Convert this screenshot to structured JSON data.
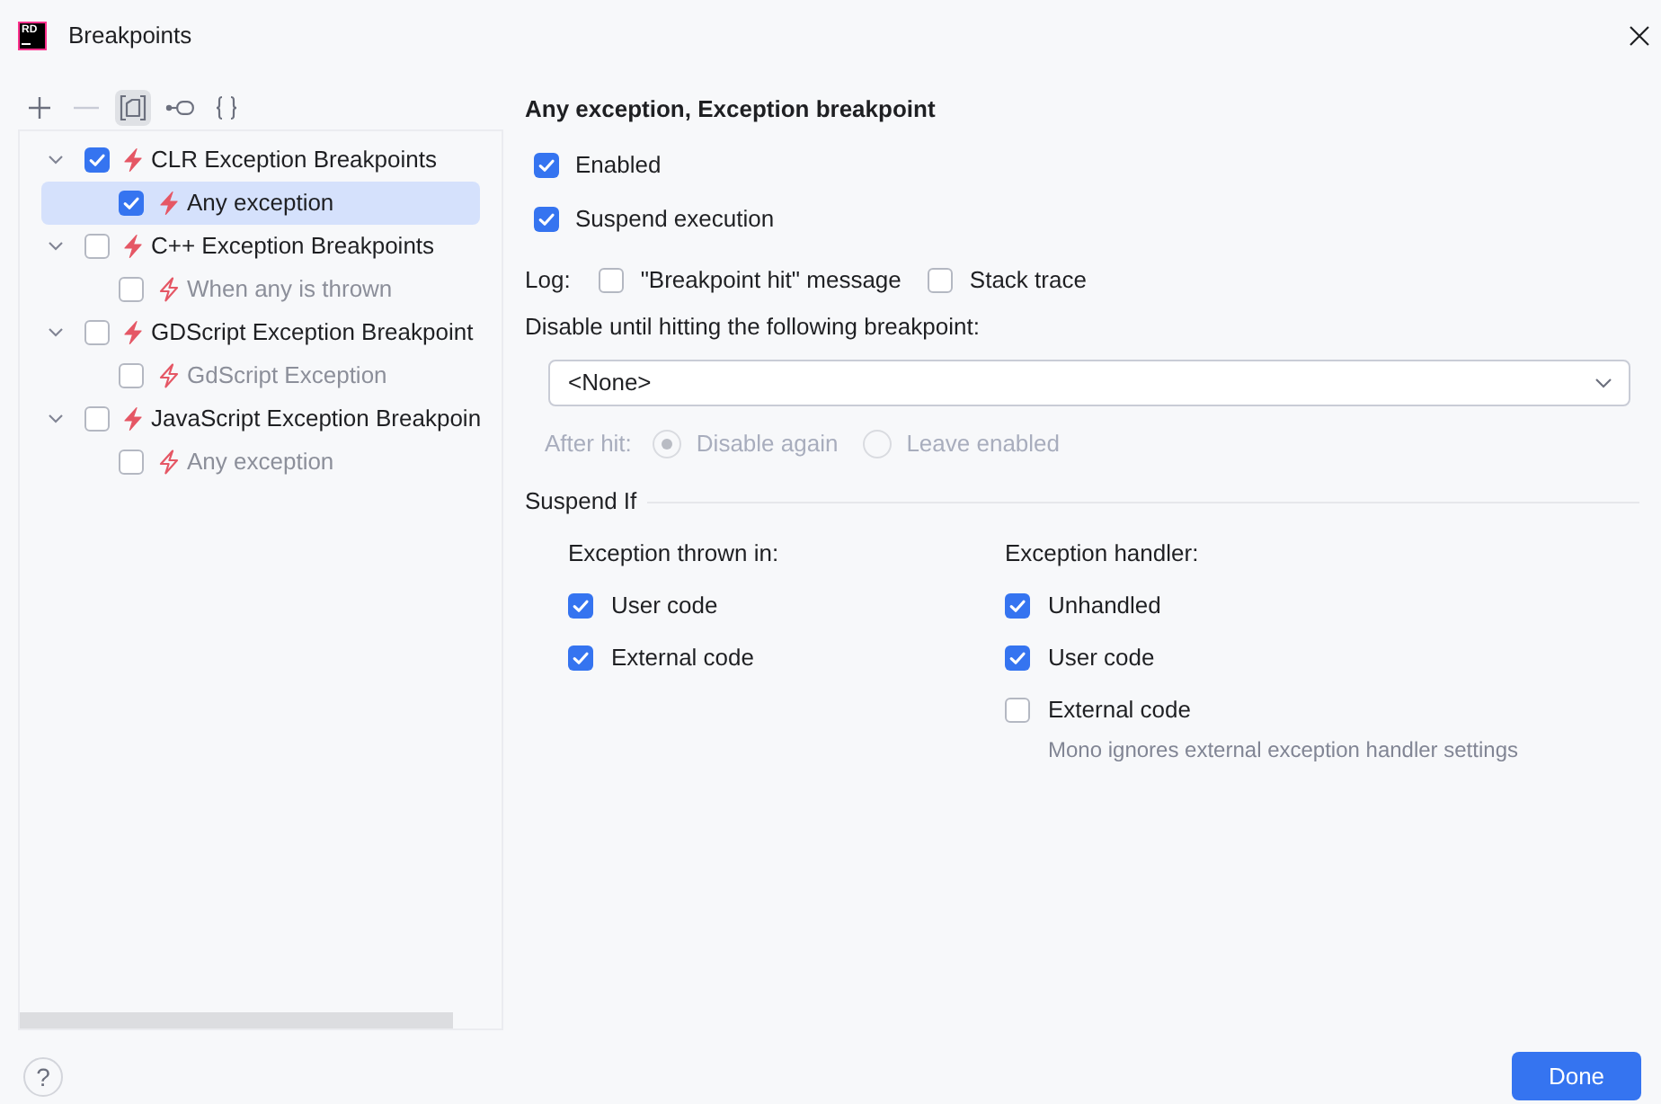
{
  "window": {
    "title": "Breakpoints",
    "logo_text": "RD"
  },
  "toolbar": [
    {
      "kind": "add",
      "disabled": false,
      "selected": false
    },
    {
      "kind": "remove",
      "disabled": true,
      "selected": false
    },
    {
      "kind": "group",
      "disabled": false,
      "selected": true
    },
    {
      "kind": "link",
      "disabled": false,
      "selected": false
    },
    {
      "kind": "braces",
      "disabled": false,
      "selected": false
    }
  ],
  "tree": [
    {
      "label": "CLR Exception Breakpoints",
      "checked": true,
      "expanded": true,
      "selected": false,
      "children": [
        {
          "label": "Any exception",
          "checked": true,
          "selected": true
        }
      ]
    },
    {
      "label": "C++ Exception Breakpoints",
      "checked": false,
      "expanded": true,
      "selected": false,
      "children": [
        {
          "label": "When any is thrown",
          "checked": false,
          "selected": false
        }
      ]
    },
    {
      "label": "GDScript Exception Breakpoint",
      "checked": false,
      "expanded": true,
      "selected": false,
      "children": [
        {
          "label": "GdScript Exception",
          "checked": false,
          "selected": false
        }
      ]
    },
    {
      "label": "JavaScript Exception Breakpoin",
      "checked": false,
      "expanded": true,
      "selected": false,
      "children": [
        {
          "label": "Any exception",
          "checked": false,
          "selected": false
        }
      ]
    }
  ],
  "details": {
    "title": "Any exception, Exception breakpoint",
    "options": [
      {
        "label": "Enabled",
        "checked": true
      },
      {
        "label": "Suspend execution",
        "checked": true
      }
    ],
    "log": {
      "label": "Log:",
      "options": [
        {
          "label": "\"Breakpoint hit\" message",
          "checked": false
        },
        {
          "label": "Stack trace",
          "checked": false
        }
      ]
    },
    "disable_until": {
      "label": "Disable until hitting the following breakpoint:",
      "value": "<None>"
    },
    "after_hit": {
      "label": "After hit:",
      "disabled": true,
      "options": [
        {
          "label": "Disable again",
          "selected": true
        },
        {
          "label": "Leave enabled",
          "selected": false
        }
      ]
    },
    "suspend_if": {
      "title": "Suspend If",
      "groups": [
        {
          "heading": "Exception thrown in:",
          "options": [
            {
              "label": "User code",
              "checked": true
            },
            {
              "label": "External code",
              "checked": true
            }
          ]
        },
        {
          "heading": "Exception handler:",
          "options": [
            {
              "label": "Unhandled",
              "checked": true
            },
            {
              "label": "User code",
              "checked": true
            },
            {
              "label": "External code",
              "checked": false
            }
          ],
          "note": "Mono ignores external exception handler settings"
        }
      ]
    }
  },
  "footer": {
    "help": "?",
    "buttons": [
      {
        "label": "Done"
      }
    ]
  }
}
